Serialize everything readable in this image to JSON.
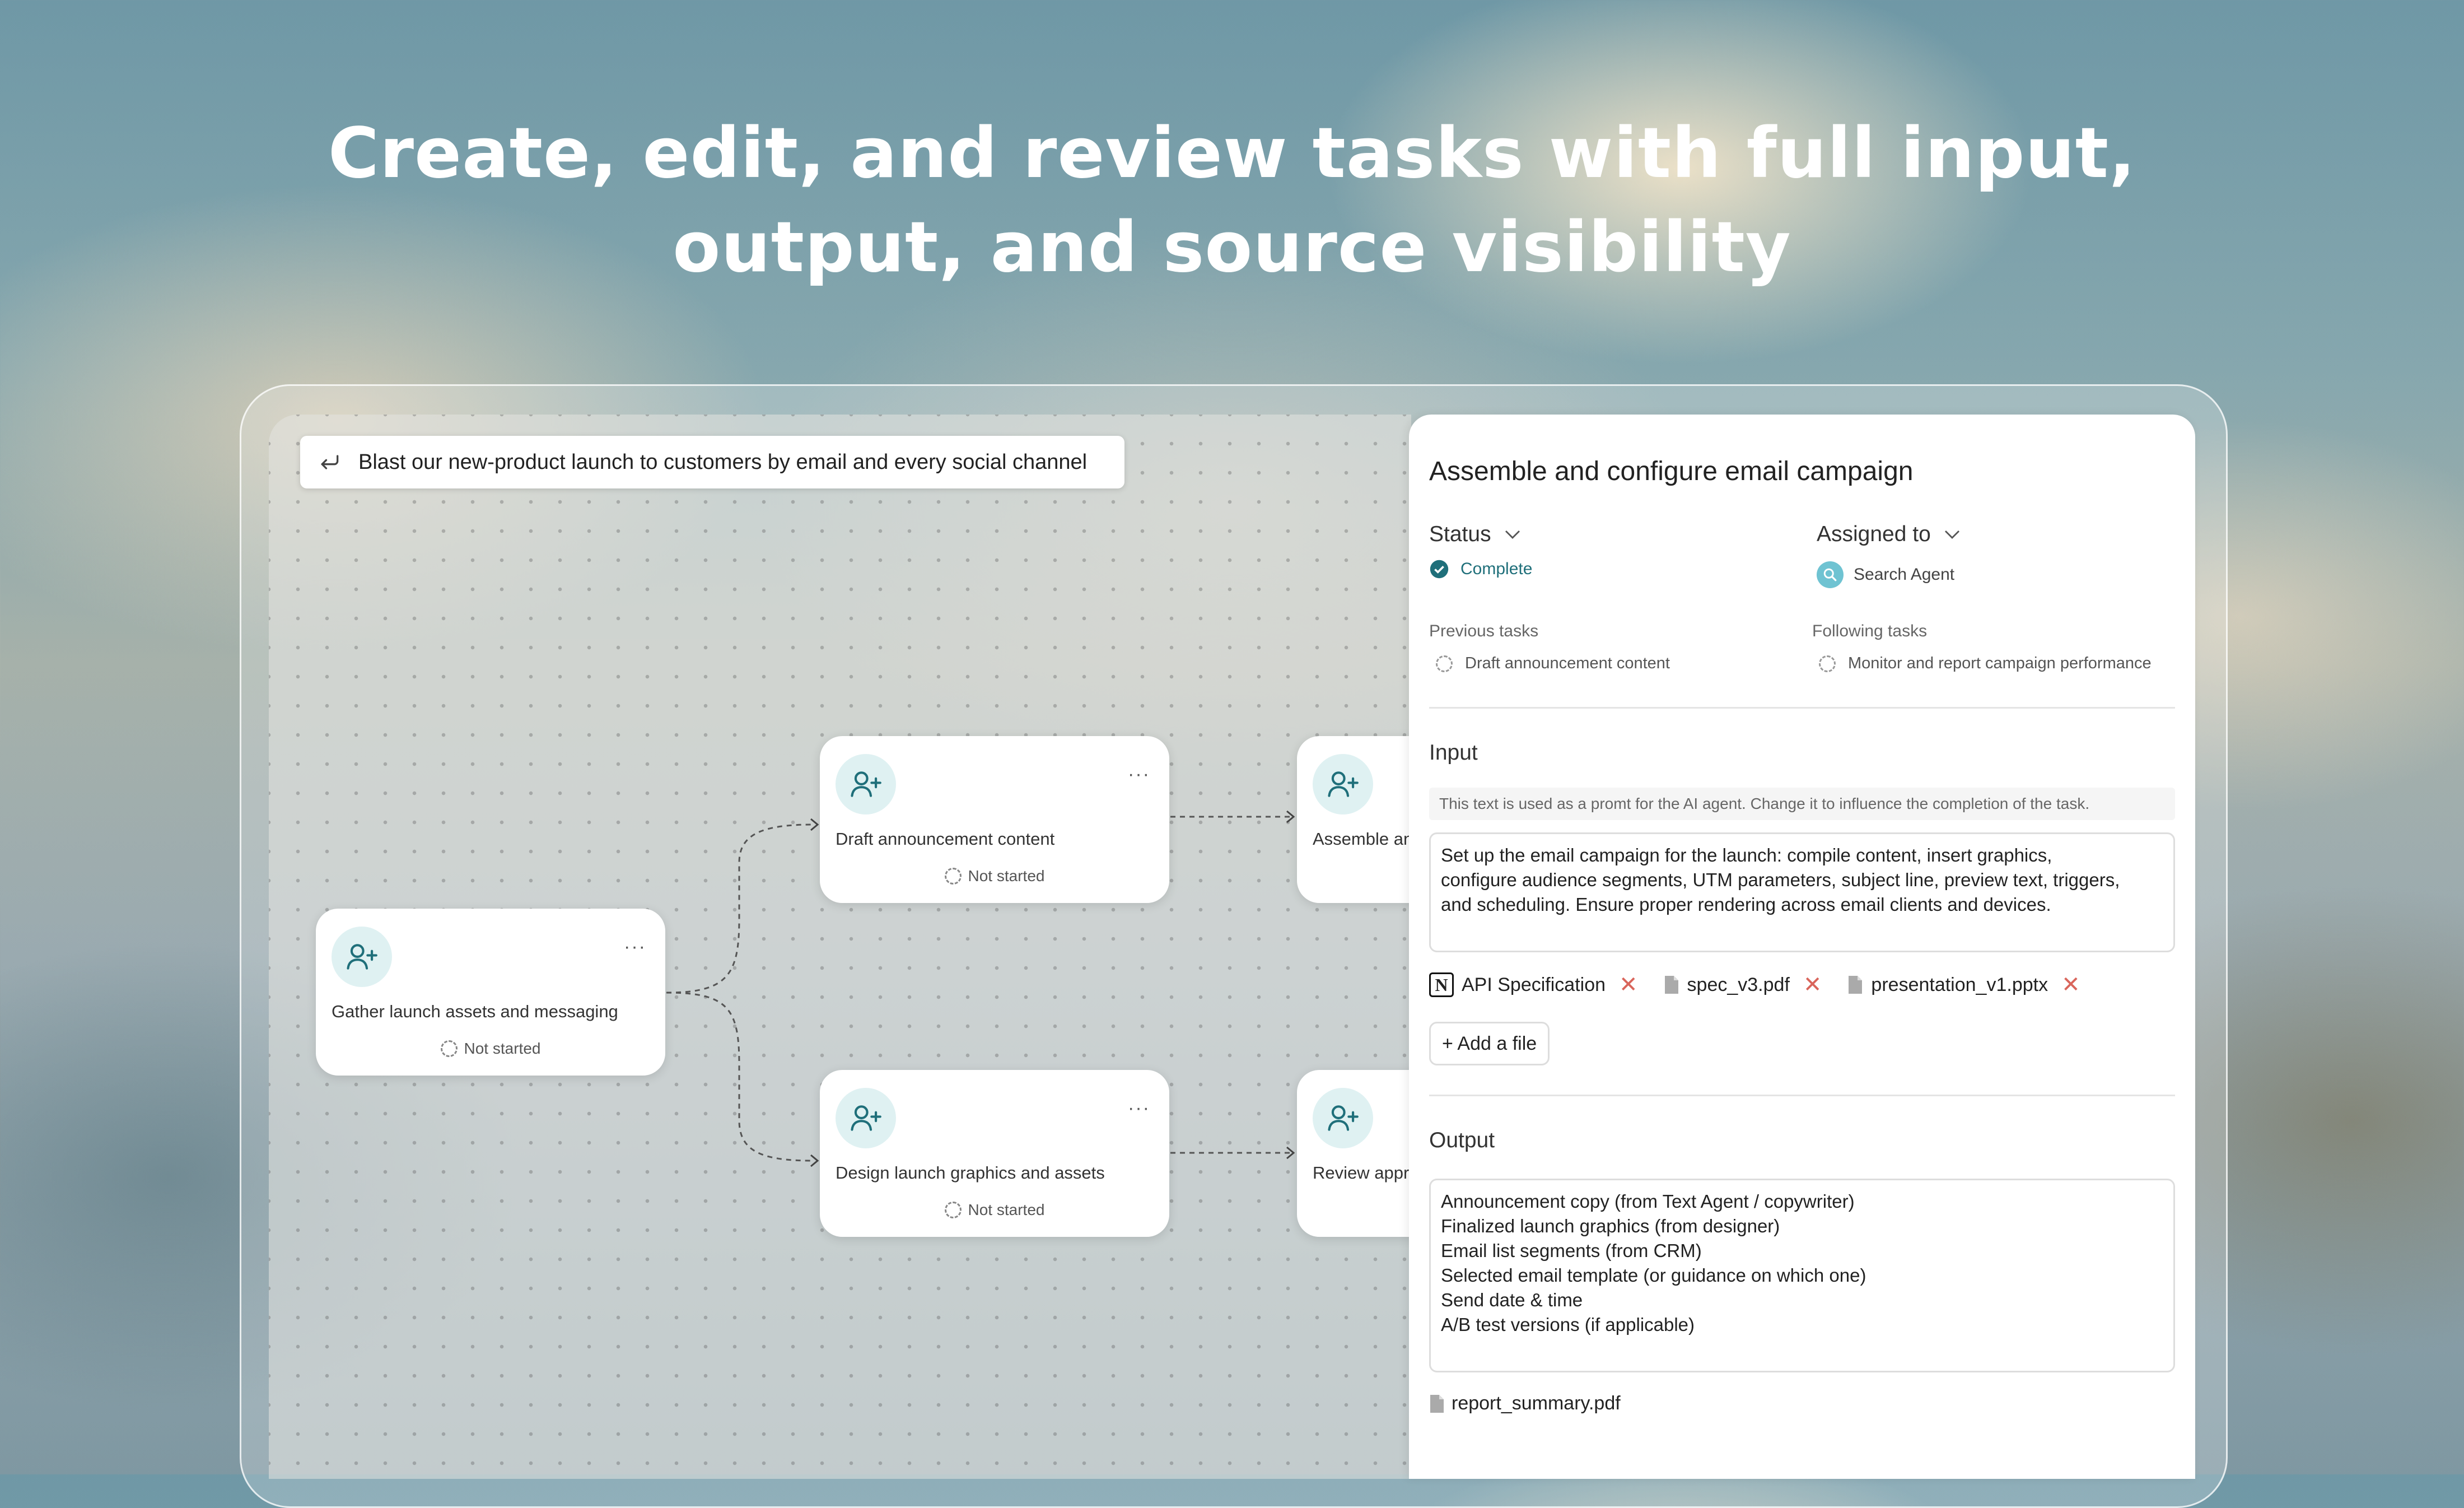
{
  "headline": {
    "line1": "Create, edit, and review tasks with full input,",
    "line2": "output, and source visibility"
  },
  "prompt_bar": {
    "icon": "return-arrow-icon",
    "text": "Blast our new-product launch to customers by email and every social channel"
  },
  "nodes": [
    {
      "title": "Gather launch assets and messaging",
      "status": "Not started",
      "menu": "···"
    },
    {
      "title": "Draft announcement content",
      "status": "Not started",
      "menu": "···"
    },
    {
      "title": "Design launch graphics and assets",
      "status": "Not started",
      "menu": "···"
    },
    {
      "title": "Assemble an"
    },
    {
      "title": "Review appr"
    }
  ],
  "panel": {
    "title": "Assemble and configure email campaign",
    "status": {
      "label": "Status",
      "value": "Complete",
      "color": "#1f6f7a"
    },
    "assigned": {
      "label": "Assigned to",
      "value": "Search Agent"
    },
    "previous": {
      "label": "Previous tasks",
      "item": "Draft announcement content"
    },
    "following": {
      "label": "Following tasks",
      "item": "Monitor and report campaign performance"
    },
    "input": {
      "label": "Input",
      "hint": "This text is used as a promt for the AI agent. Change it to influence the completion of the task.",
      "lines": [
        "Set up the email campaign for the launch: compile content, insert graphics,",
        "configure audience segments, UTM parameters, subject line, preview text, triggers,",
        "and scheduling. Ensure proper rendering across email clients and devices."
      ],
      "files": [
        {
          "name": "API Specification",
          "icon": "notion-icon"
        },
        {
          "name": "spec_v3.pdf",
          "icon": "file-icon"
        },
        {
          "name": "presentation_v1.pptx",
          "icon": "file-icon"
        }
      ],
      "remove_glyph": "✕",
      "add_file": "+ Add a file"
    },
    "output": {
      "label": "Output",
      "lines": [
        "Announcement copy (from Text Agent / copywriter)",
        "Finalized launch graphics (from designer)",
        "Email list segments (from CRM)",
        "Selected email template (or guidance on which one)",
        "Send date & time",
        "A/B test versions (if applicable)"
      ],
      "file": "report_summary.pdf"
    }
  },
  "colors": {
    "accent": "#1f6f7a",
    "avatar_bg": "#dff1f2",
    "remove": "#d9655b"
  }
}
